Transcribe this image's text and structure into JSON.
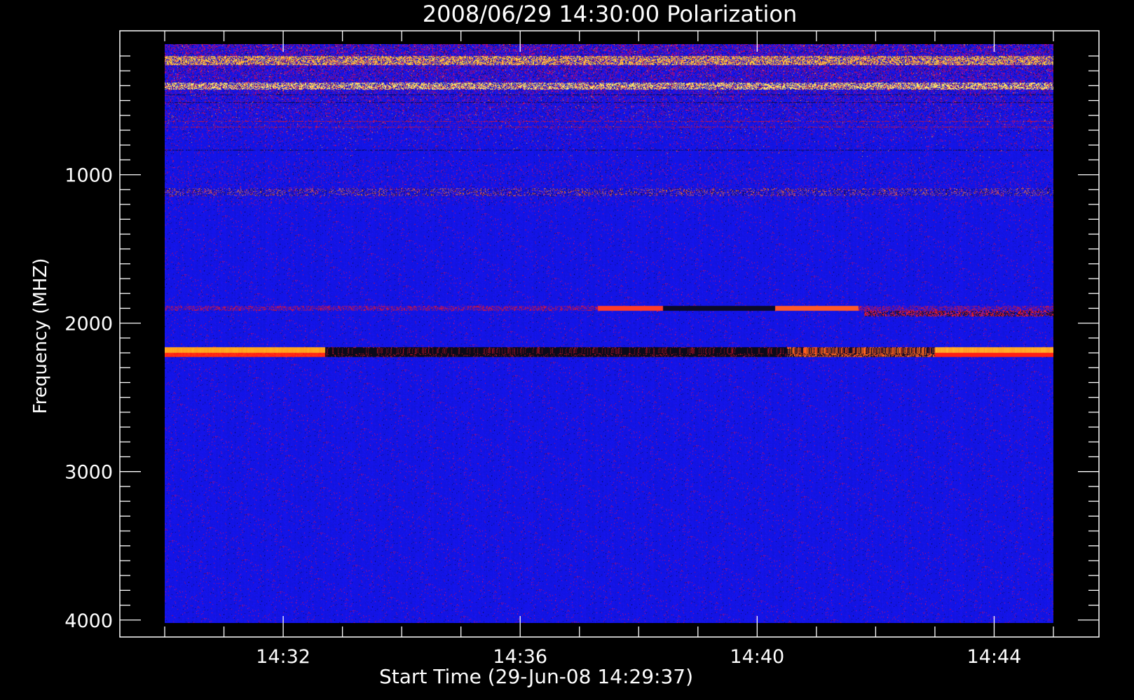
{
  "chart_data": {
    "type": "heatmap",
    "title": "2008/06/29  14:30:00 Polarization",
    "xlabel": "Start Time (29-Jun-08 14:29:37)",
    "ylabel": "Frequency (MHZ)",
    "y_ticks": [
      1000,
      2000,
      3000,
      4000
    ],
    "y_tick_labels": [
      "1000",
      "2000",
      "3000",
      "4000"
    ],
    "ylim": [
      120,
      4020
    ],
    "y_inverted": true,
    "x_tick_labels": [
      "14:32",
      "14:36",
      "14:40",
      "14:44"
    ],
    "x_ticks_min": [
      2,
      6,
      10,
      14
    ],
    "xlim_min": [
      0,
      15
    ],
    "colormap": [
      "#000000",
      "#1010ff",
      "#ff1010",
      "#ffa020",
      "#ffff80"
    ],
    "features": [
      {
        "name": "rfi-band-low",
        "freq": 2190,
        "t_start": 0,
        "t_end": 15,
        "bright_until": 2.7,
        "dark_from": 2.7,
        "dark_until": 10.5
      },
      {
        "name": "rfi-band-mid",
        "freq": 1900,
        "t_start": 0,
        "t_end": 15
      },
      {
        "name": "rfi-band-top",
        "freq": 230,
        "t_start": 0,
        "t_end": 15
      },
      {
        "name": "rfi-band-top2",
        "freq": 400,
        "t_start": 0,
        "t_end": 15
      },
      {
        "name": "rfi-band-1100",
        "freq": 1120,
        "t_start": 0,
        "t_end": 15
      }
    ]
  }
}
